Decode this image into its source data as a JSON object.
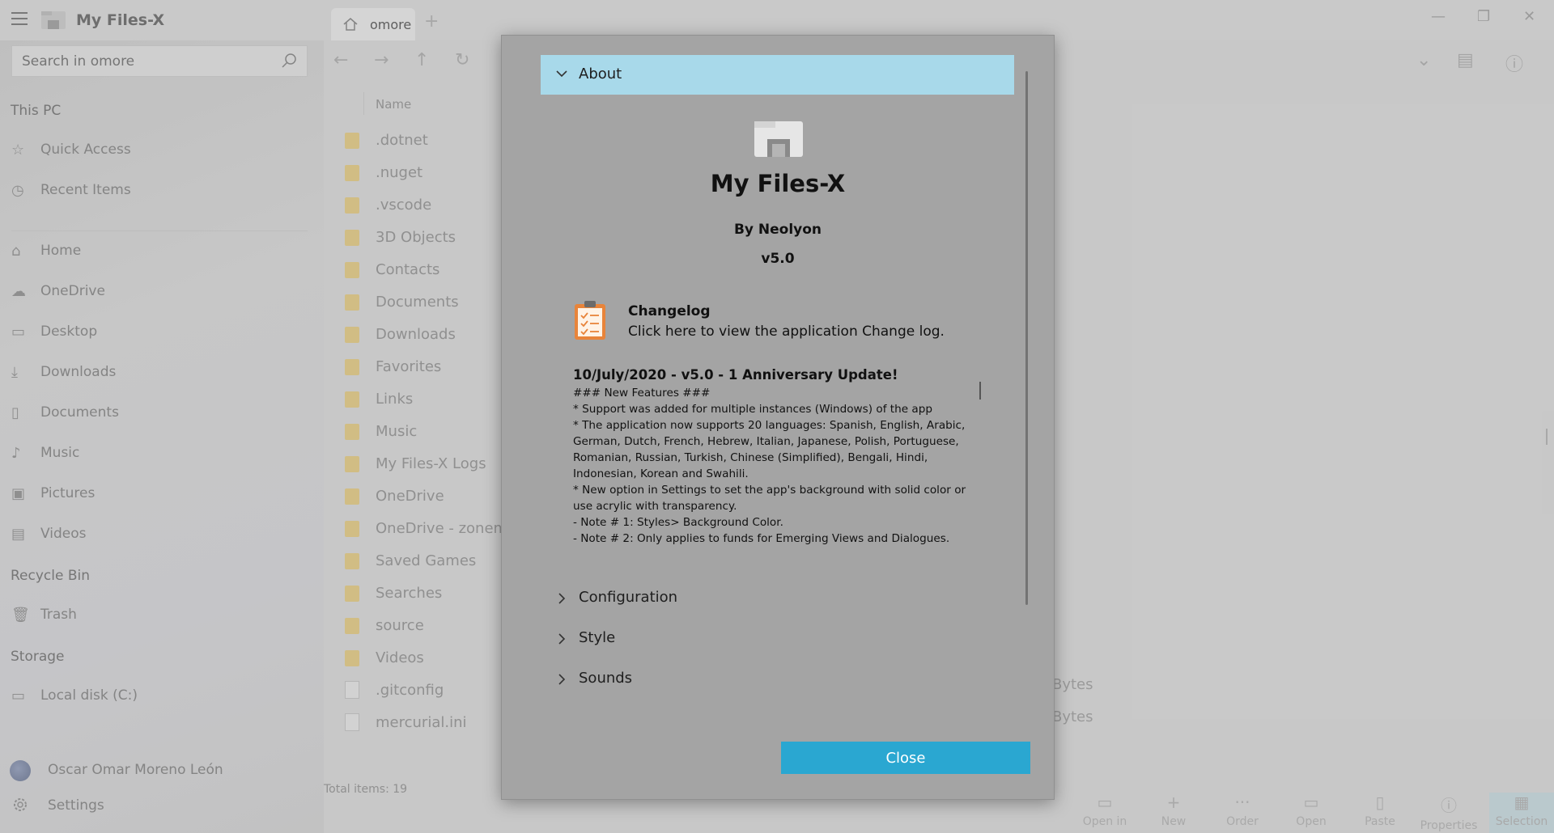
{
  "titlebar": {
    "app_title": "My Files-X",
    "tab_label": "omore",
    "tab_add": "+",
    "minimize": "—",
    "restore": "❐",
    "close": "✕"
  },
  "sidebar": {
    "search_placeholder": "Search in omore",
    "sections": {
      "this_pc": "This PC",
      "recycle_bin": "Recycle Bin",
      "storage": "Storage"
    },
    "quick": [
      {
        "label": "Quick Access",
        "icon": "star-icon",
        "glyph": "☆"
      },
      {
        "label": "Recent Items",
        "icon": "clock-icon",
        "glyph": "◷"
      }
    ],
    "places": [
      {
        "label": "Home",
        "icon": "home-icon",
        "glyph": "⌂"
      },
      {
        "label": "OneDrive",
        "icon": "cloud-icon",
        "glyph": "☁"
      },
      {
        "label": "Desktop",
        "icon": "desktop-icon",
        "glyph": "▭"
      },
      {
        "label": "Downloads",
        "icon": "download-icon",
        "glyph": "⤓"
      },
      {
        "label": "Documents",
        "icon": "document-icon",
        "glyph": "▯"
      },
      {
        "label": "Music",
        "icon": "music-icon",
        "glyph": "♪"
      },
      {
        "label": "Pictures",
        "icon": "picture-icon",
        "glyph": "▣"
      },
      {
        "label": "Videos",
        "icon": "video-icon",
        "glyph": "▤"
      }
    ],
    "trash": {
      "label": "Trash",
      "icon": "trash-icon",
      "glyph": "🗑"
    },
    "local_disk": {
      "label": "Local disk (C:)",
      "icon": "drive-icon",
      "glyph": "▭"
    },
    "user_name": "Oscar Omar Moreno León",
    "settings_label": "Settings"
  },
  "main": {
    "column_name": "Name",
    "files": [
      {
        "name": ".dotnet",
        "type": "folder"
      },
      {
        "name": ".nuget",
        "type": "folder"
      },
      {
        "name": ".vscode",
        "type": "folder"
      },
      {
        "name": "3D Objects",
        "type": "folder"
      },
      {
        "name": "Contacts",
        "type": "folder"
      },
      {
        "name": "Documents",
        "type": "folder"
      },
      {
        "name": "Downloads",
        "type": "folder"
      },
      {
        "name": "Favorites",
        "type": "folder"
      },
      {
        "name": "Links",
        "type": "folder"
      },
      {
        "name": "Music",
        "type": "folder"
      },
      {
        "name": "My Files-X Logs",
        "type": "folder"
      },
      {
        "name": "OneDrive",
        "type": "folder"
      },
      {
        "name": "OneDrive - zonema",
        "type": "folder"
      },
      {
        "name": "Saved Games",
        "type": "folder"
      },
      {
        "name": "Searches",
        "type": "folder"
      },
      {
        "name": "source",
        "type": "folder"
      },
      {
        "name": "Videos",
        "type": "folder"
      },
      {
        "name": ".gitconfig",
        "type": "file"
      },
      {
        "name": "mercurial.ini",
        "type": "file"
      }
    ],
    "size_label_1": "Bytes",
    "size_label_2": "Bytes",
    "total_items": "Total items: 19",
    "bottom_bar": [
      {
        "label": "Open in",
        "glyph": "▭"
      },
      {
        "label": "New",
        "glyph": "+"
      },
      {
        "label": "Order",
        "glyph": "···"
      },
      {
        "label": "Open",
        "glyph": "▭"
      },
      {
        "label": "Paste",
        "glyph": "▯"
      },
      {
        "label": "Properties",
        "glyph": "ⓘ"
      },
      {
        "label": "Selection",
        "glyph": "▦"
      }
    ]
  },
  "dialog": {
    "about_header": "About",
    "app_name": "My Files-X",
    "author": "By Neolyon",
    "version": "v5.0",
    "changelog_title": "Changelog",
    "changelog_desc": "Click here to view the application Change log.",
    "notes_title": "10/July/2020 - v5.0 - 1 Anniversary Update!",
    "notes_lines": [
      "### New Features ###",
      "* Support was added for multiple instances (Windows) of the app",
      "* The application now supports 20 languages: Spanish, English, Arabic, German, Dutch, French, Hebrew, Italian, Japanese, Polish, Portuguese, Romanian, Russian, Turkish, Chinese (Simplified), Bengali, Hindi, Indonesian, Korean and Swahili.",
      "* New option in Settings to set the app's background with solid color or use acrylic with transparency.",
      "- Note # 1: Styles> Background Color.",
      "- Note # 2: Only applies to funds for Emerging Views and Dialogues."
    ],
    "sections": [
      "Configuration",
      "Style",
      "Sounds"
    ],
    "close_label": "Close"
  },
  "colors": {
    "accent_blue": "#2aa7d1",
    "about_header_bg": "#a8d9ea",
    "folder_yellow": "#f4d88a",
    "dialog_bg": "#a4a4a4"
  }
}
